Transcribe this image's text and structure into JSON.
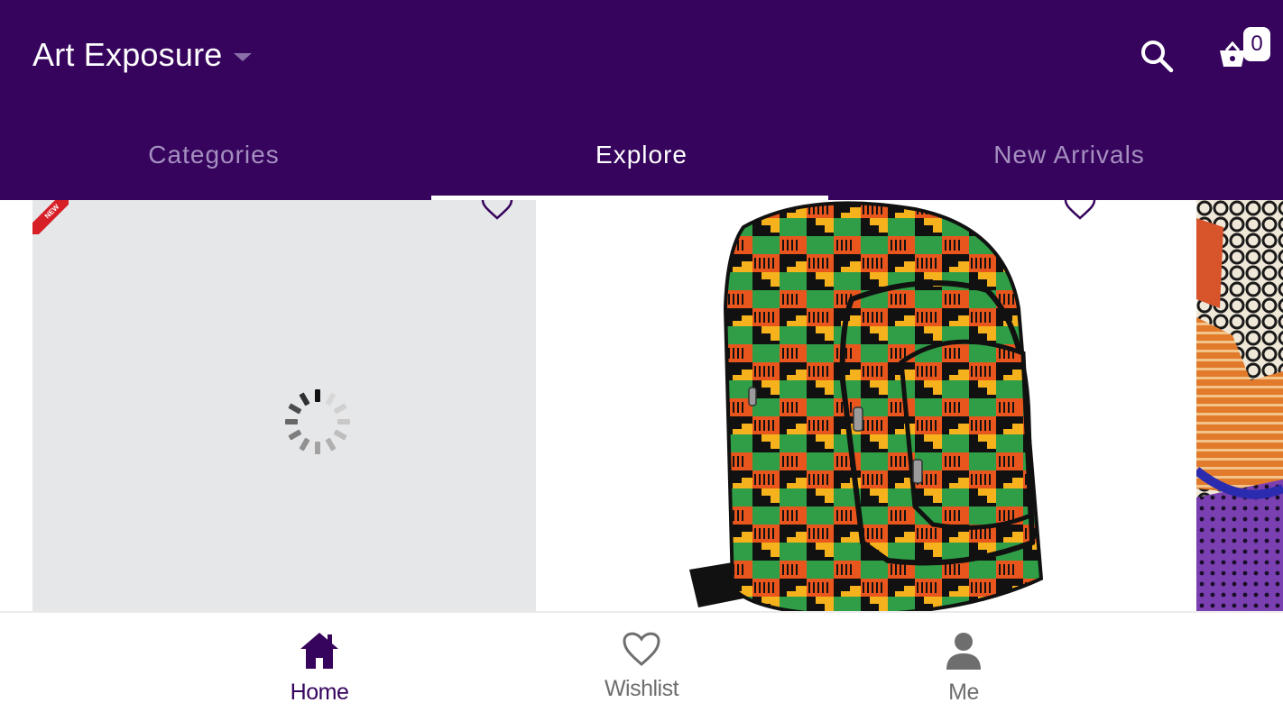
{
  "header": {
    "store_name": "Art Exposure",
    "cart_count": "0",
    "icons": {
      "search": "search-icon",
      "cart": "basket-icon",
      "dropdown": "caret-down-icon"
    }
  },
  "tabs": [
    {
      "label": "Categories",
      "active": false
    },
    {
      "label": "Explore",
      "active": true
    },
    {
      "label": "New Arrivals",
      "active": false
    }
  ],
  "products": [
    {
      "state": "loading",
      "badge": "NEW",
      "wishlist_icon": "heart-outline-icon"
    },
    {
      "state": "loaded",
      "image": "kente-backpack",
      "wishlist_icon": "heart-outline-icon"
    },
    {
      "state": "loaded",
      "image": "african-print-fabric"
    }
  ],
  "bottom_nav": [
    {
      "label": "Home",
      "icon": "home-icon",
      "active": true
    },
    {
      "label": "Wishlist",
      "icon": "heart-outline-icon",
      "active": false
    },
    {
      "label": "Me",
      "icon": "person-icon",
      "active": false
    }
  ],
  "colors": {
    "primary": "#36045d",
    "tab_inactive": "#a58fc0",
    "loading_bg": "#e6e7e9",
    "ribbon": "#d61f26",
    "nav_inactive": "#6e6e6e"
  }
}
